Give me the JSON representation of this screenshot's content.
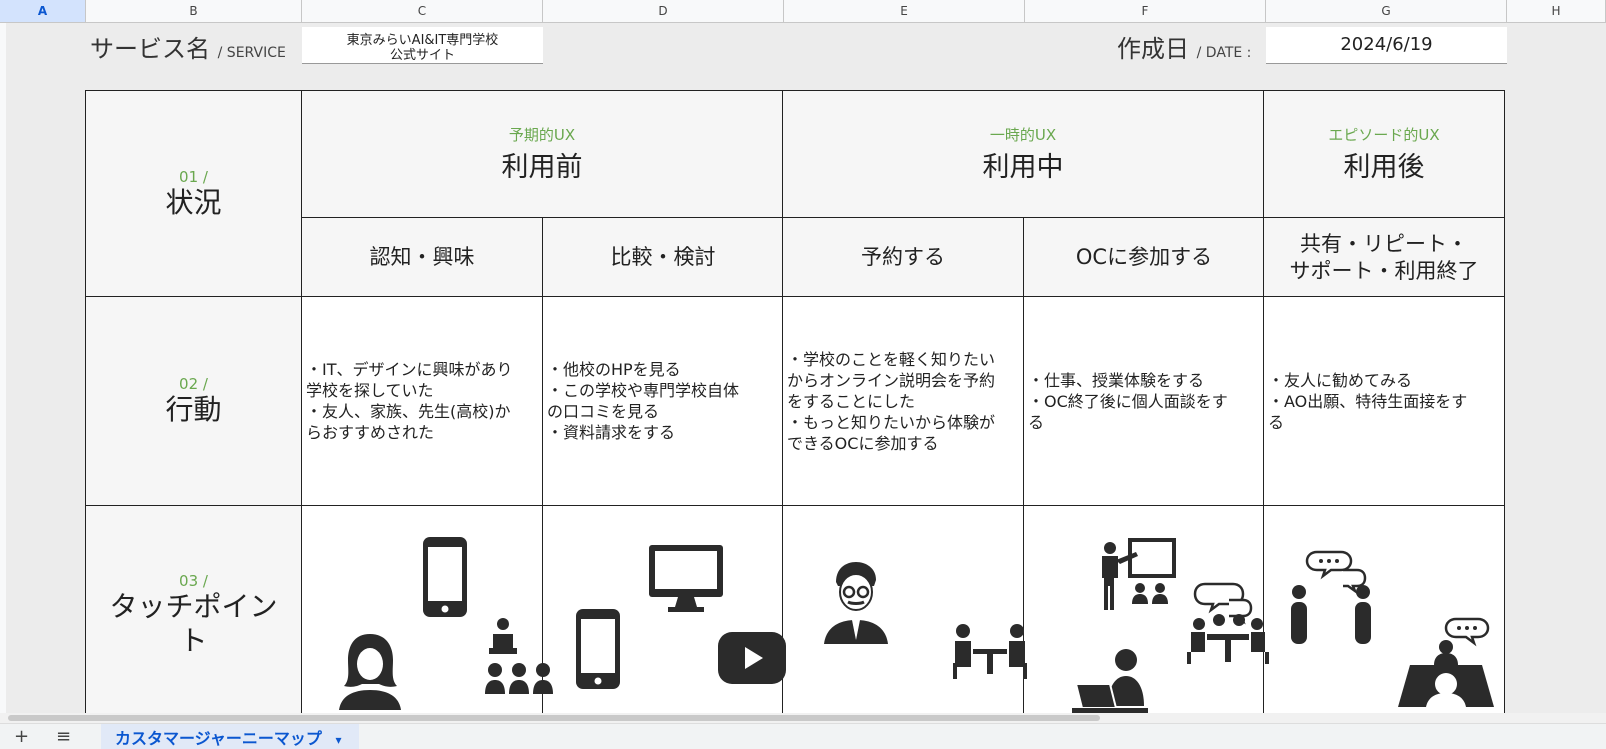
{
  "columns": [
    "A",
    "B",
    "C",
    "D",
    "E",
    "F",
    "G",
    "H"
  ],
  "header": {
    "service_label": "サービス名",
    "service_sub": "/ SERVICE",
    "service_value_line1": "東京みらいAI&IT専門学校",
    "service_value_line2": "公式サイト",
    "date_label": "作成日",
    "date_sub": "/ DATE :",
    "date_value": "2024/6/19"
  },
  "rows": {
    "situation": {
      "num": "01 /",
      "title": "状況"
    },
    "action": {
      "num": "02 /",
      "title": "行動"
    },
    "touchpoint": {
      "num": "03 /",
      "title_line1": "タッチポイン",
      "title_line2": "ト"
    }
  },
  "phases": [
    {
      "ux": "予期的UX",
      "name": "利用前"
    },
    {
      "ux": "一時的UX",
      "name": "利用中"
    },
    {
      "ux": "エピソード的UX",
      "name": "利用後"
    }
  ],
  "stages": [
    "認知・興味",
    "比較・検討",
    "予約する",
    "OCに参加する",
    "共有・リピート・",
    "サポート・利用終了"
  ],
  "actions": [
    [
      "・IT、デザインに興味があり",
      "学校を探していた",
      "・友人、家族、先生(高校)か",
      "らおすすめされた"
    ],
    [
      "・他校のHPを見る",
      "・この学校や専門学校自体",
      "の口コミを見る",
      "・資料請求をする"
    ],
    [
      "・学校のことを軽く知りたい",
      "からオンライン説明会を予約",
      "をすることにした",
      "・もっと知りたいから体験が",
      "できるOCに参加する"
    ],
    [
      "・仕事、授業体験をする",
      "・OC終了後に個人面談をす",
      "る"
    ],
    [
      "・友人に勧めてみる",
      "・AO出願、特待生面接をす",
      "る"
    ]
  ],
  "icons": [
    "woman-icon",
    "smartphone-icon",
    "seminar-icon",
    "smartphone-icon",
    "monitor-icon",
    "youtube-icon",
    "man-glasses-icon",
    "meeting-table-icon",
    "presenter-icon",
    "laptop-user-icon",
    "group-talk-icon",
    "chatting-people-icon",
    "consultation-icon"
  ],
  "footer": {
    "add": "+",
    "menu": "≡",
    "sheet_tab": "カスタマージャーニーマップ",
    "tab_arrow": "▾"
  },
  "colors": {
    "accent_green": "#6aa84f",
    "icon_dark": "#2b2b2b",
    "selected_blue": "#0b57d0"
  }
}
